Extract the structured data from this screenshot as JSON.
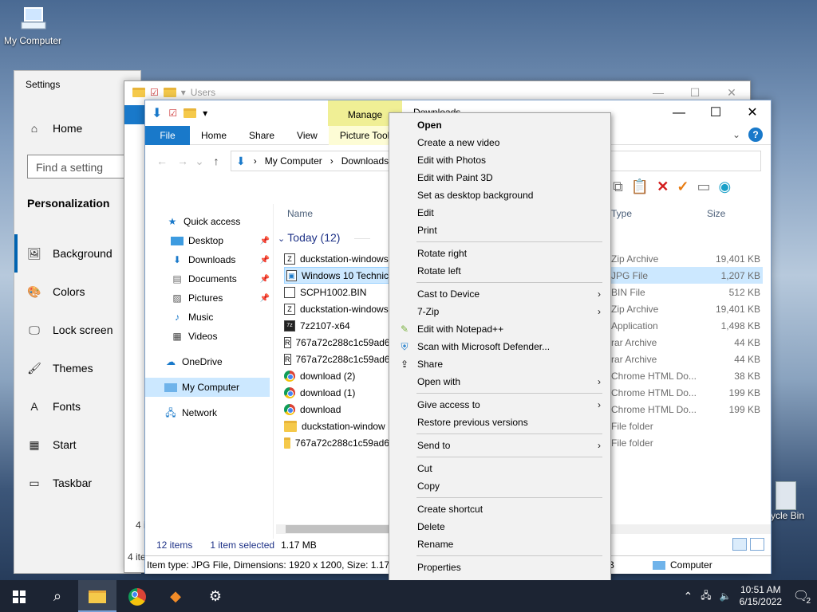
{
  "desktop": {
    "my_computer_label": "My Computer",
    "recycle_label": "ycle Bin"
  },
  "settings": {
    "title": "Settings",
    "home": "Home",
    "search_placeholder": "Find a setting",
    "section": "Personalization",
    "nav": [
      {
        "label": "Background",
        "icon": "🖼"
      },
      {
        "label": "Colors",
        "icon": "🎨"
      },
      {
        "label": "Lock screen",
        "icon": "🖵"
      },
      {
        "label": "Themes",
        "icon": "🖌"
      },
      {
        "label": "Fonts",
        "icon": "A"
      },
      {
        "label": "Start",
        "icon": "▦"
      },
      {
        "label": "Taskbar",
        "icon": "▭"
      }
    ]
  },
  "back_window": {
    "title": "Users",
    "status": "4 ite",
    "status2": "4 i"
  },
  "explorer": {
    "manage_label": "Manage",
    "title": "Downloads",
    "controls": {
      "minimize": "—",
      "maximize": "☐",
      "close": "✕"
    },
    "tabs": {
      "file": "File",
      "home": "Home",
      "share": "Share",
      "view": "View",
      "picture_tools": "Picture Tools"
    },
    "help": "?",
    "breadcrumb": {
      "root": "My Computer",
      "sep": "›",
      "current": "Downloads"
    },
    "columns": {
      "name": "Name",
      "type": "Type",
      "size": "Size"
    },
    "group": "Today (12)",
    "nav": {
      "quick_access": "Quick access",
      "desktop": "Desktop",
      "downloads": "Downloads",
      "documents": "Documents",
      "pictures": "Pictures",
      "music": "Music",
      "videos": "Videos",
      "onedrive": "OneDrive",
      "my_computer": "My Computer",
      "network": "Network"
    },
    "files": [
      {
        "name": "duckstation-windows",
        "type": "Zip Archive",
        "size": "19,401 KB",
        "icon": "Z"
      },
      {
        "name": "Windows 10 Technic",
        "type": "JPG File",
        "size": "1,207 KB",
        "icon": "▣"
      },
      {
        "name": "SCPH1002.BIN",
        "type": "BIN File",
        "size": "512 KB",
        "icon": ""
      },
      {
        "name": "duckstation-windows",
        "type": "Zip Archive",
        "size": "19,401 KB",
        "icon": "Z"
      },
      {
        "name": "7z2107-x64",
        "type": "Application",
        "size": "1,498 KB",
        "icon": "7z"
      },
      {
        "name": "767a72c288c1c59ad6",
        "type": "rar Archive",
        "size": "44 KB",
        "icon": "R"
      },
      {
        "name": "767a72c288c1c59ad6",
        "type": "rar Archive",
        "size": "44 KB",
        "icon": "R"
      },
      {
        "name": "download (2)",
        "type": "Chrome HTML Do...",
        "size": "38 KB",
        "icon": "chrome"
      },
      {
        "name": "download (1)",
        "type": "Chrome HTML Do...",
        "size": "199 KB",
        "icon": "chrome"
      },
      {
        "name": "download",
        "type": "Chrome HTML Do...",
        "size": "199 KB",
        "icon": "chrome"
      },
      {
        "name": "duckstation-window",
        "type": "File folder",
        "size": "",
        "icon": "folder"
      },
      {
        "name": "767a72c288c1c59ad6",
        "type": "File folder",
        "size": "",
        "icon": "folder"
      }
    ],
    "status": {
      "items": "12 items",
      "selected": "1 item selected",
      "size": "1.17 MB"
    },
    "infobar": {
      "text": "Item type: JPG File, Dimensions: 1920 x 1200, Size: 1.17 MB",
      "kb": "B",
      "location": "Computer"
    }
  },
  "context_menu": {
    "groups": [
      [
        {
          "label": "Open",
          "bold": true
        },
        {
          "label": "Create a new video"
        },
        {
          "label": "Edit with Photos"
        },
        {
          "label": "Edit with Paint 3D"
        },
        {
          "label": "Set as desktop background"
        },
        {
          "label": "Edit"
        },
        {
          "label": "Print"
        }
      ],
      [
        {
          "label": "Rotate right"
        },
        {
          "label": "Rotate left"
        }
      ],
      [
        {
          "label": "Cast to Device",
          "submenu": true
        },
        {
          "label": "7-Zip",
          "submenu": true
        },
        {
          "label": "Edit with Notepad++",
          "icon": "notepad-plus-plus-icon"
        },
        {
          "label": "Scan with Microsoft Defender...",
          "icon": "defender-shield-icon"
        },
        {
          "label": "Share",
          "icon": "share-icon"
        },
        {
          "label": "Open with",
          "submenu": true
        }
      ],
      [
        {
          "label": "Give access to",
          "submenu": true
        },
        {
          "label": "Restore previous versions"
        }
      ],
      [
        {
          "label": "Send to",
          "submenu": true
        }
      ],
      [
        {
          "label": "Cut"
        },
        {
          "label": "Copy"
        }
      ],
      [
        {
          "label": "Create shortcut"
        },
        {
          "label": "Delete"
        },
        {
          "label": "Rename"
        }
      ],
      [
        {
          "label": "Properties"
        }
      ]
    ]
  },
  "taskbar": {
    "time": "10:51 AM",
    "date": "6/15/2022",
    "notifications": "2",
    "apps": [
      "windows-start-icon",
      "search-icon",
      "file-explorer-icon",
      "chrome-icon",
      "package-icon",
      "settings-gear-icon"
    ]
  },
  "colors": {
    "accent": "#1979ca",
    "selection": "#cce8ff",
    "manage_tab": "#f0ef95"
  }
}
